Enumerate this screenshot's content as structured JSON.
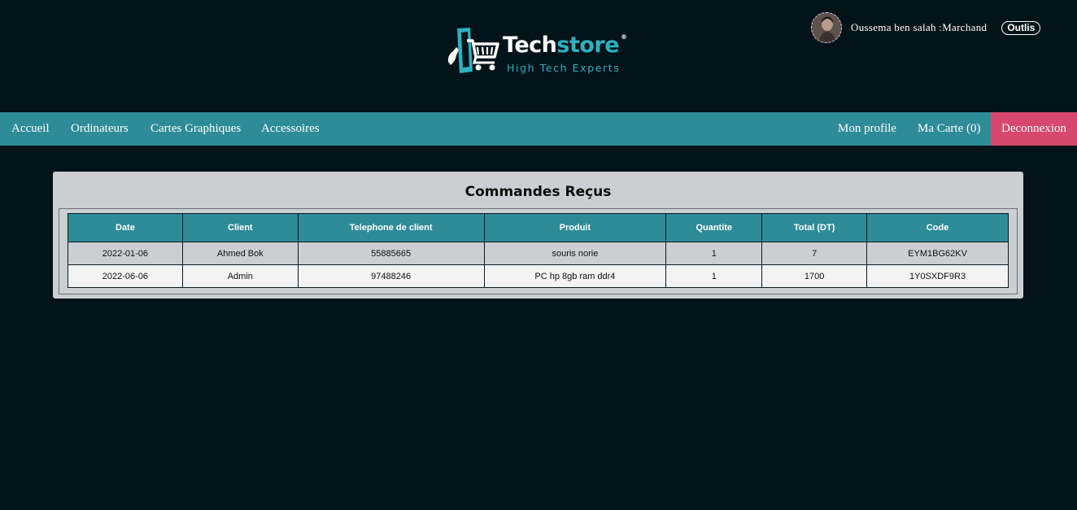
{
  "header": {
    "logo": {
      "word_main": "Tech",
      "word_accent": "store",
      "registered": "®",
      "tagline": "High Tech Experts"
    },
    "user": {
      "label": "Oussema ben salah :Marchand",
      "tools_label": "Outlis"
    }
  },
  "nav": {
    "left": [
      "Accueil",
      "Ordinateurs",
      "Cartes Graphiques",
      "Accessoires"
    ],
    "profile": "Mon profile",
    "cart": "Ma Carte (0)",
    "logout": "Deconnexion"
  },
  "orders": {
    "title": "Commandes Reçus",
    "columns": [
      "Date",
      "Client",
      "Telephone de client",
      "Produit",
      "Quantite",
      "Total (DT)",
      "Code"
    ],
    "rows": [
      [
        "2022-01-06",
        "Ahmed Bok",
        "55885665",
        "souris norie",
        "1",
        "7",
        "EYM1BG62KV"
      ],
      [
        "2022-06-06",
        "Admin",
        "97488246",
        "PC hp 8gb ram ddr4",
        "1",
        "1700",
        "1Y0SXDF9R3"
      ]
    ]
  },
  "colors": {
    "background": "#02131a",
    "nav": "#2e8b98",
    "accent": "#2db1bf",
    "logout": "#d8476c",
    "card": "#cbcfd3"
  },
  "icons": {
    "logo": "phone-cart-logo-icon",
    "avatar": "user-avatar"
  }
}
